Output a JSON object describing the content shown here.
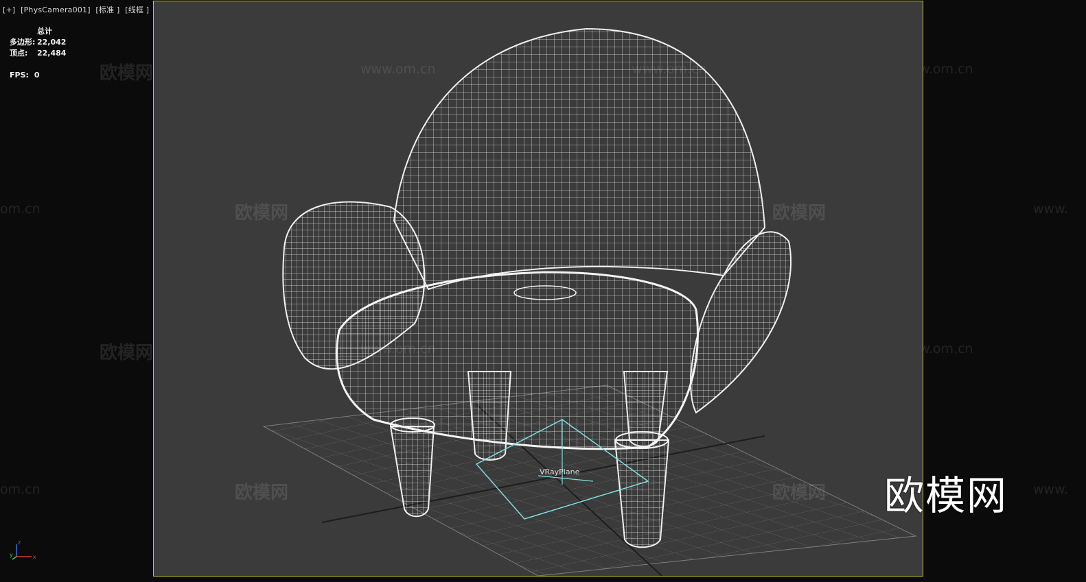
{
  "viewport": {
    "label_plus": "[+]",
    "label_camera": "[PhysCamera001]",
    "label_shading": "[标准 ]",
    "label_mode": "[线框 ]"
  },
  "stats": {
    "header": "总计",
    "polygons_label": "多边形:",
    "polygons_value": "22,042",
    "vertices_label": "顶点:",
    "vertices_value": "22,484",
    "fps_label": "FPS:",
    "fps_value": "0"
  },
  "scene": {
    "object_label": "VRayPlane",
    "wire_color": "#e8e8e8",
    "plane_color": "#7fe0e0",
    "grid_color": "#8a8a8a"
  },
  "watermarks": {
    "brand": "欧模网",
    "url": "www.om.cn",
    "url_fragment_left": "om.cn",
    "url_fragment_right": "www."
  },
  "axis": {
    "z": "z",
    "y": "y",
    "x": "x"
  },
  "colors": {
    "viewport_border": "#c9c23a",
    "viewport_bg": "#3b3b3b",
    "sidebar_bg": "#0b0b0b"
  }
}
